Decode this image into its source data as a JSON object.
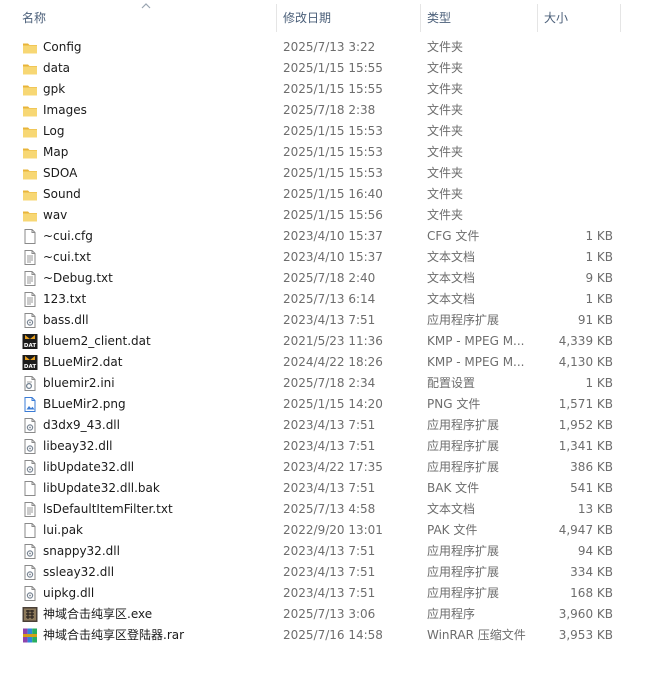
{
  "columns": {
    "name": "名称",
    "date": "修改日期",
    "type": "类型",
    "size": "大小"
  },
  "colors": {
    "folder": "#f2c94c",
    "header_text": "#4c607a",
    "secondary_text": "#6d6d6d"
  },
  "files": [
    {
      "name": "Config",
      "date": "2025/7/13 3:22",
      "type": "文件夹",
      "size": "",
      "icon": "folder-icon"
    },
    {
      "name": "data",
      "date": "2025/1/15 15:55",
      "type": "文件夹",
      "size": "",
      "icon": "folder-icon"
    },
    {
      "name": "gpk",
      "date": "2025/1/15 15:55",
      "type": "文件夹",
      "size": "",
      "icon": "folder-icon"
    },
    {
      "name": "Images",
      "date": "2025/7/18 2:38",
      "type": "文件夹",
      "size": "",
      "icon": "folder-icon"
    },
    {
      "name": "Log",
      "date": "2025/1/15 15:53",
      "type": "文件夹",
      "size": "",
      "icon": "folder-icon"
    },
    {
      "name": "Map",
      "date": "2025/1/15 15:53",
      "type": "文件夹",
      "size": "",
      "icon": "folder-icon"
    },
    {
      "name": "SDOA",
      "date": "2025/1/15 15:53",
      "type": "文件夹",
      "size": "",
      "icon": "folder-icon"
    },
    {
      "name": "Sound",
      "date": "2025/1/15 16:40",
      "type": "文件夹",
      "size": "",
      "icon": "folder-icon"
    },
    {
      "name": "wav",
      "date": "2025/1/15 15:56",
      "type": "文件夹",
      "size": "",
      "icon": "folder-icon"
    },
    {
      "name": "~cui.cfg",
      "date": "2023/4/10 15:37",
      "type": "CFG 文件",
      "size": "1 KB",
      "icon": "file-icon"
    },
    {
      "name": "~cui.txt",
      "date": "2023/4/10 15:37",
      "type": "文本文档",
      "size": "1 KB",
      "icon": "text-file-icon"
    },
    {
      "name": "~Debug.txt",
      "date": "2025/7/18 2:40",
      "type": "文本文档",
      "size": "9 KB",
      "icon": "text-file-icon"
    },
    {
      "name": "123.txt",
      "date": "2025/7/13 6:14",
      "type": "文本文档",
      "size": "1 KB",
      "icon": "text-file-icon"
    },
    {
      "name": "bass.dll",
      "date": "2023/4/13 7:51",
      "type": "应用程序扩展",
      "size": "91 KB",
      "icon": "dll-icon"
    },
    {
      "name": "bluem2_client.dat",
      "date": "2021/5/23 11:36",
      "type": "KMP - MPEG M...",
      "size": "4,339 KB",
      "icon": "dat-icon"
    },
    {
      "name": "BLueMir2.dat",
      "date": "2024/4/22 18:26",
      "type": "KMP - MPEG M...",
      "size": "4,130 KB",
      "icon": "dat-icon"
    },
    {
      "name": "bluemir2.ini",
      "date": "2025/7/18 2:34",
      "type": "配置设置",
      "size": "1 KB",
      "icon": "ini-icon"
    },
    {
      "name": "BLueMir2.png",
      "date": "2025/1/15 14:20",
      "type": "PNG 文件",
      "size": "1,571 KB",
      "icon": "image-file-icon"
    },
    {
      "name": "d3dx9_43.dll",
      "date": "2023/4/13 7:51",
      "type": "应用程序扩展",
      "size": "1,952 KB",
      "icon": "dll-icon"
    },
    {
      "name": "libeay32.dll",
      "date": "2023/4/13 7:51",
      "type": "应用程序扩展",
      "size": "1,341 KB",
      "icon": "dll-icon"
    },
    {
      "name": "libUpdate32.dll",
      "date": "2023/4/22 17:35",
      "type": "应用程序扩展",
      "size": "386 KB",
      "icon": "dll-icon"
    },
    {
      "name": "libUpdate32.dll.bak",
      "date": "2023/4/13 7:51",
      "type": "BAK 文件",
      "size": "541 KB",
      "icon": "file-icon"
    },
    {
      "name": "lsDefaultItemFilter.txt",
      "date": "2025/7/13 4:58",
      "type": "文本文档",
      "size": "13 KB",
      "icon": "text-file-icon"
    },
    {
      "name": "lui.pak",
      "date": "2022/9/20 13:01",
      "type": "PAK 文件",
      "size": "4,947 KB",
      "icon": "file-icon"
    },
    {
      "name": "snappy32.dll",
      "date": "2023/4/13 7:51",
      "type": "应用程序扩展",
      "size": "94 KB",
      "icon": "dll-icon"
    },
    {
      "name": "ssleay32.dll",
      "date": "2023/4/13 7:51",
      "type": "应用程序扩展",
      "size": "334 KB",
      "icon": "dll-icon"
    },
    {
      "name": "uipkg.dll",
      "date": "2023/4/13 7:51",
      "type": "应用程序扩展",
      "size": "168 KB",
      "icon": "dll-icon"
    },
    {
      "name": "神域合击纯享区.exe",
      "date": "2025/7/13 3:06",
      "type": "应用程序",
      "size": "3,960 KB",
      "icon": "exe-icon"
    },
    {
      "name": "神域合击纯享区登陆器.rar",
      "date": "2025/7/16 14:58",
      "type": "WinRAR 压缩文件",
      "size": "3,953 KB",
      "icon": "rar-icon"
    }
  ]
}
